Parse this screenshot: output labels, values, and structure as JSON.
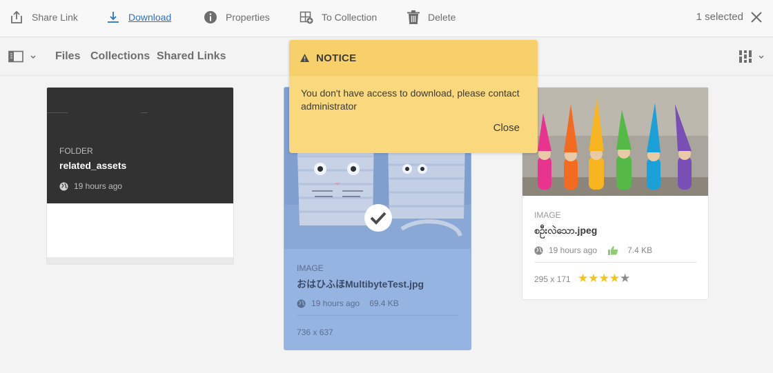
{
  "actionbar": {
    "share_link": "Share Link",
    "download": "Download",
    "properties": "Properties",
    "to_collection": "To Collection",
    "delete": "Delete",
    "selected_count": "1 selected"
  },
  "nav": {
    "tabs": [
      "Files",
      "Collections",
      "Shared Links"
    ]
  },
  "cards": [
    {
      "type": "FOLDER",
      "name": "related_assets",
      "modified": "19 hours ago"
    },
    {
      "type": "IMAGE",
      "name": "おはひふほMultibyteTest.jpg",
      "modified": "19 hours ago",
      "size": "69.4 KB",
      "dimensions": "736 x 637",
      "selected": true
    },
    {
      "type": "IMAGE",
      "name": "စဦးလဲသော.jpeg",
      "modified": "19 hours ago",
      "size": "7.4 KB",
      "dimensions": "295 x 171",
      "rating": 4,
      "rating_max": 5
    }
  ],
  "notice": {
    "title": "NOTICE",
    "message": "You don't have access to download, please contact administrator",
    "close": "Close"
  },
  "colors": {
    "accent": "#2d70c9",
    "notice_bg": "#f9d87e",
    "selected_card": "#96b4e2",
    "star": "#f5c518"
  }
}
